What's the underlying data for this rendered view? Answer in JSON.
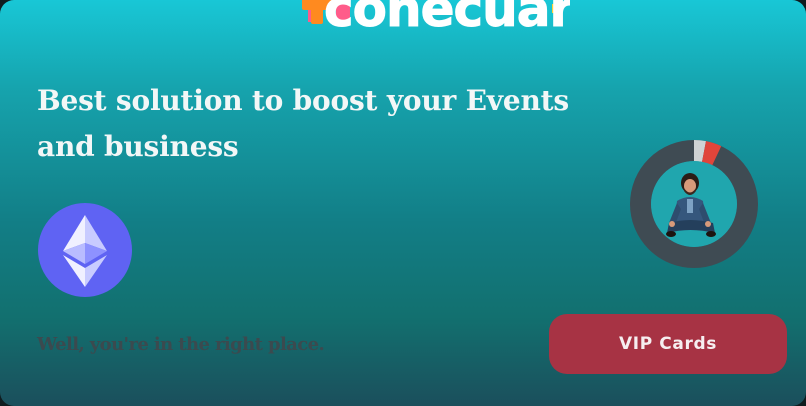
{
  "brand": {
    "logo_text": "conecuar"
  },
  "hero": {
    "headline": "Best solution to boost your Events and business",
    "tagline": "Well, you're in the right place."
  },
  "eth_badge": {
    "icon": "ethereum-icon",
    "color": "#5f63f3"
  },
  "profile": {
    "progress_ring": {
      "segments": [
        {
          "color": "#cfd3d4",
          "fraction": 0.03
        },
        {
          "color": "#e0453a",
          "fraction": 0.04
        }
      ],
      "track_color": "#3f4b53"
    },
    "avatar_icon": "person-avatar"
  },
  "cta": {
    "vip_label": "VIP Cards",
    "color": "#a73344"
  }
}
